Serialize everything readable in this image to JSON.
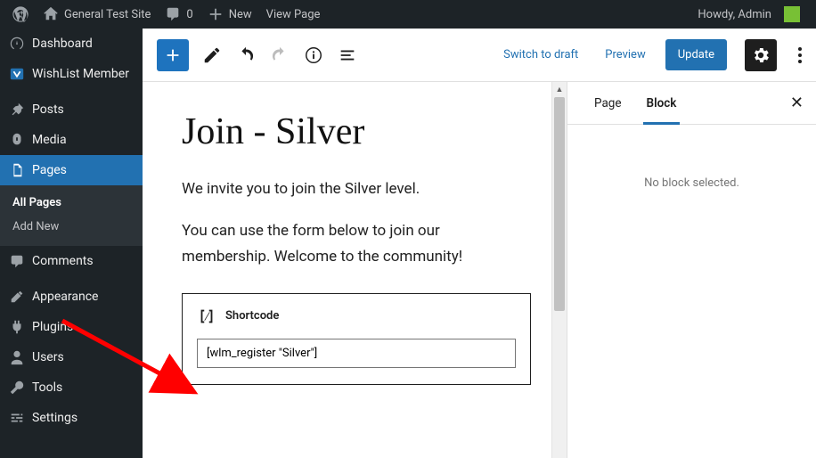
{
  "adminbar": {
    "site_name": "General Test Site",
    "comments_count": "0",
    "new_label": "New",
    "view_page_label": "View Page",
    "howdy": "Howdy, Admin"
  },
  "sidebar": {
    "dashboard": "Dashboard",
    "wishlist": "WishList Member",
    "posts": "Posts",
    "media": "Media",
    "pages": "Pages",
    "all_pages": "All Pages",
    "add_new": "Add New",
    "comments": "Comments",
    "appearance": "Appearance",
    "plugins": "Plugins",
    "users": "Users",
    "tools": "Tools",
    "settings": "Settings"
  },
  "toolbar": {
    "switch_draft": "Switch to draft",
    "preview": "Preview",
    "update": "Update"
  },
  "editor": {
    "title": "Join - Silver",
    "para1": "We invite you to join the Silver level.",
    "para2": "You can use the form below to join our membership. Welcome to the community!",
    "shortcode_label": "Shortcode",
    "shortcode_value": "[wlm_register \"Silver\"]"
  },
  "panel": {
    "tab_page": "Page",
    "tab_block": "Block",
    "empty": "No block selected."
  }
}
